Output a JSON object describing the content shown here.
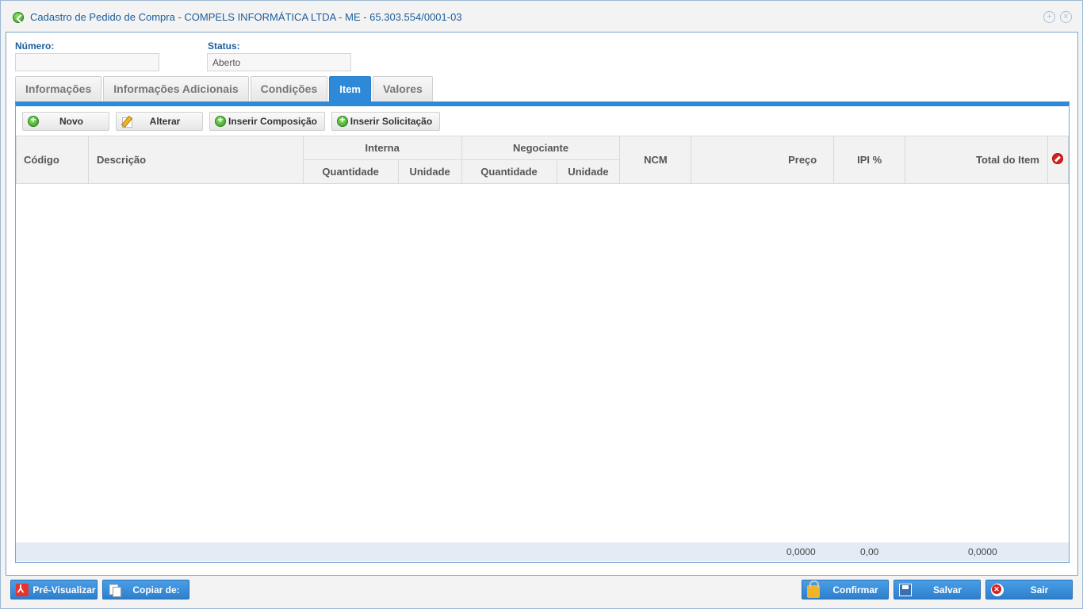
{
  "window": {
    "title": "Cadastro de Pedido de Compra - COMPELS INFORMÁTICA LTDA - ME - 65.303.554/0001-03"
  },
  "form": {
    "numero_label": "Número:",
    "numero_value": "",
    "status_label": "Status:",
    "status_value": "Aberto"
  },
  "tabs": [
    {
      "label": "Informações",
      "active": false
    },
    {
      "label": "Informações Adicionais",
      "active": false
    },
    {
      "label": "Condições",
      "active": false
    },
    {
      "label": "Item",
      "active": true
    },
    {
      "label": "Valores",
      "active": false
    }
  ],
  "toolbar": {
    "novo": "Novo",
    "alterar": "Alterar",
    "inserir_composicao": "Inserir Composição",
    "inserir_solicitacao": "Inserir Solicitação"
  },
  "grid": {
    "headers": {
      "codigo": "Código",
      "descricao": "Descrição",
      "interna": "Interna",
      "negociante": "Negociante",
      "quantidade": "Quantidade",
      "unidade": "Unidade",
      "ncm": "NCM",
      "preco": "Preço",
      "ipi": "IPI %",
      "total": "Total do Item"
    },
    "rows": [],
    "totals": {
      "preco": "0,0000",
      "ipi": "0,00",
      "total": "0,0000"
    }
  },
  "footer": {
    "preview": "Pré-Visualizar",
    "copy": "Copiar de:",
    "confirm": "Confirmar",
    "save": "Salvar",
    "exit": "Sair"
  },
  "colors": {
    "accent": "#2e8ad8",
    "title": "#1c5d9c"
  }
}
